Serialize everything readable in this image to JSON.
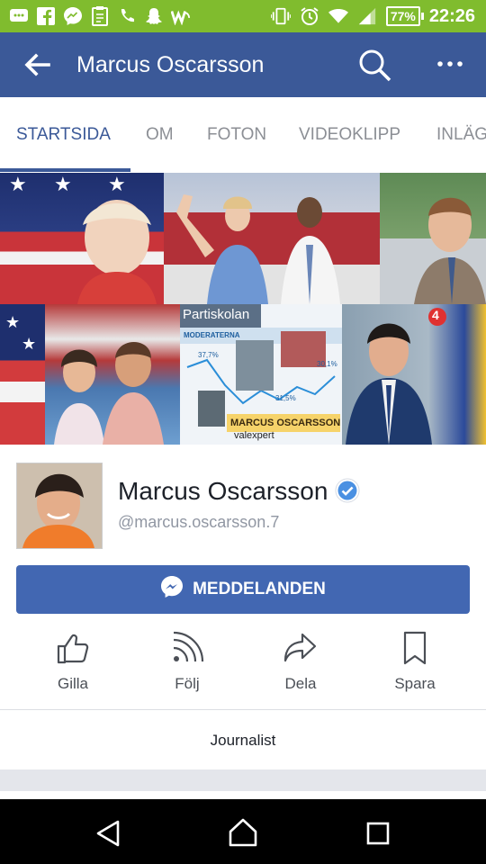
{
  "status_bar": {
    "battery": "77%",
    "time": "22:26",
    "icons": [
      "message-icon",
      "facebook-icon",
      "messenger-icon",
      "clipboard-icon",
      "phone-icon",
      "snapchat-icon",
      "w-app-icon",
      "vibrate-icon",
      "alarm-icon",
      "wifi-icon",
      "signal-icon"
    ]
  },
  "app_bar": {
    "title": "Marcus Oscarsson",
    "color": "#3b5998"
  },
  "tabs": [
    {
      "label": "STARTSIDA",
      "active": true
    },
    {
      "label": "OM",
      "active": false
    },
    {
      "label": "FOTON",
      "active": false
    },
    {
      "label": "VIDEOKLIPP",
      "active": false
    },
    {
      "label": "INLÄG",
      "active": false
    }
  ],
  "cover": {
    "overlay_text": {
      "partiskolan": "Partiskolan",
      "moderaterna": "MODERATERNA",
      "pct1": "37,7%",
      "pct2": "31,5%",
      "pct3": "30,1%",
      "name_banner": "MARCUS OSCARSSON",
      "subtitle": "valexpert",
      "channel": "4"
    }
  },
  "profile": {
    "name": "Marcus Oscarsson",
    "handle": "@marcus.oscarsson.7",
    "verified": true
  },
  "message_button": {
    "label": "MEDDELANDEN"
  },
  "actions": [
    {
      "label": "Gilla",
      "icon": "thumbs-up-icon"
    },
    {
      "label": "Följ",
      "icon": "rss-icon"
    },
    {
      "label": "Dela",
      "icon": "share-icon"
    },
    {
      "label": "Spara",
      "icon": "bookmark-icon"
    }
  ],
  "category": "Journalist"
}
